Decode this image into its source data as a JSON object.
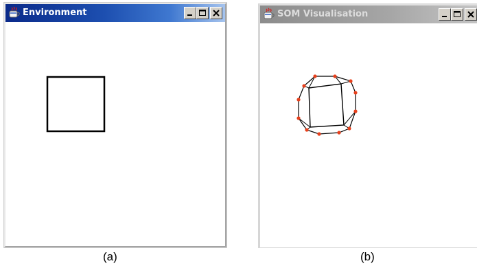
{
  "windows": {
    "environment": {
      "title": "Environment"
    },
    "som": {
      "title": "SOM Visualisation"
    }
  },
  "captions": {
    "a": "(a)",
    "b": "(b)"
  },
  "icons": {
    "app": "java-coffee-cup-icon",
    "minimize": "minimize-icon",
    "maximize": "maximize-icon",
    "close": "close-icon"
  },
  "colors": {
    "active_titlebar": "#0a2a8a",
    "inactive_titlebar": "#a6a6a6",
    "som_node": "#e8401c",
    "edges": "#000000"
  }
}
